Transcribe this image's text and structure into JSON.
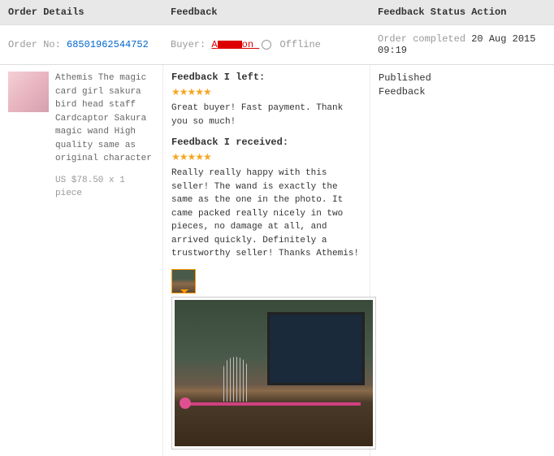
{
  "headers": {
    "col1": "Order Details",
    "col2": "Feedback",
    "col3": "Feedback Status Action"
  },
  "subrow": {
    "orderNoLabel": "Order No:",
    "orderNo": "68501962544752",
    "buyerLabel": "Buyer:",
    "buyerPrefix": "A",
    "buyerSuffix": "on",
    "offlineLabel": "Offline",
    "statusLabel": "Order completed",
    "statusDate": "20 Aug 2015 09:19"
  },
  "product": {
    "title": "Athemis The magic card girl sakura bird head staff Cardcaptor Sakura magic wand High quality same as original character",
    "price": "US $78.50 x 1 piece"
  },
  "feedback": {
    "leftTitle": "Feedback I left:",
    "leftText": "Great buyer! Fast payment. Thank you so much!",
    "receivedTitle": "Feedback I received:",
    "receivedText": "Really really happy with this seller! The wand is exactly the same as the one in the photo. It came packed really nicely in two pieces, no damage at all, and arrived quickly. Definitely a trustworthy seller! Thanks Athemis!",
    "stars": "★★★★★",
    "closeLabel": "×"
  },
  "status": {
    "line1": "Published",
    "line2": "Feedback"
  }
}
